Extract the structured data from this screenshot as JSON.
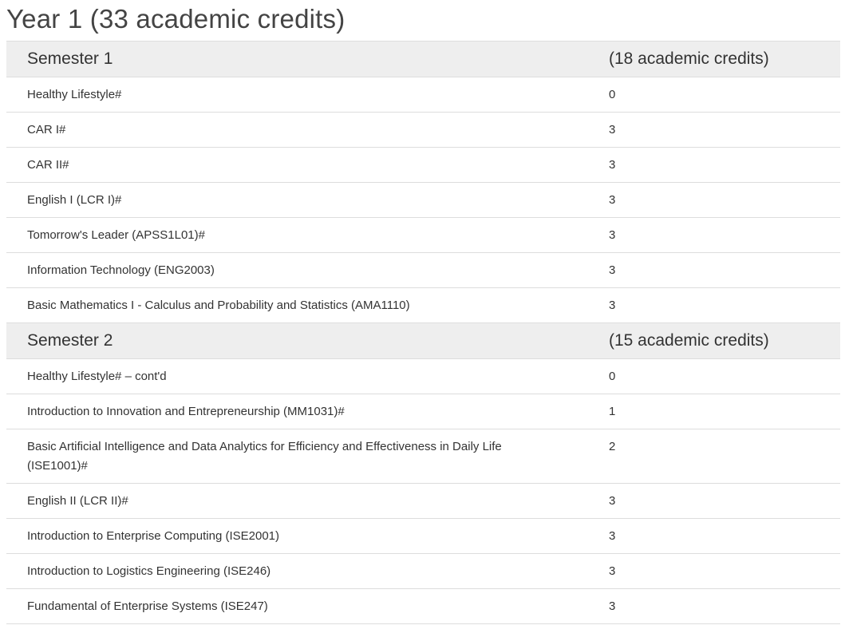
{
  "title": "Year 1 (33 academic credits)",
  "semesters": [
    {
      "name": "Semester 1",
      "credits": "(18 academic credits)",
      "courses": [
        {
          "name": "Healthy Lifestyle#",
          "credits": "0"
        },
        {
          "name": "CAR I#",
          "credits": "3"
        },
        {
          "name": "CAR II#",
          "credits": "3"
        },
        {
          "name": "English I (LCR I)#",
          "credits": "3"
        },
        {
          "name": "Tomorrow's Leader (APSS1L01)#",
          "credits": "3"
        },
        {
          "name": "Information Technology (ENG2003)",
          "credits": "3"
        },
        {
          "name": "Basic Mathematics I - Calculus and Probability and Statistics (AMA1110)",
          "credits": "3"
        }
      ]
    },
    {
      "name": "Semester 2",
      "credits": "(15 academic credits)",
      "courses": [
        {
          "name": "Healthy Lifestyle# – cont'd",
          "credits": "0"
        },
        {
          "name": "Introduction to Innovation and Entrepreneurship (MM1031)#",
          "credits": "1"
        },
        {
          "name": "Basic Artificial Intelligence and Data Analytics for Efficiency and Effectiveness in Daily Life (ISE1001)#",
          "credits": "2"
        },
        {
          "name": "English II (LCR II)#",
          "credits": "3"
        },
        {
          "name": "Introduction to Enterprise Computing (ISE2001)",
          "credits": "3"
        },
        {
          "name": "Introduction to Logistics Engineering (ISE246)",
          "credits": "3"
        },
        {
          "name": "Fundamental of Enterprise Systems (ISE247)",
          "credits": "3"
        }
      ]
    }
  ]
}
